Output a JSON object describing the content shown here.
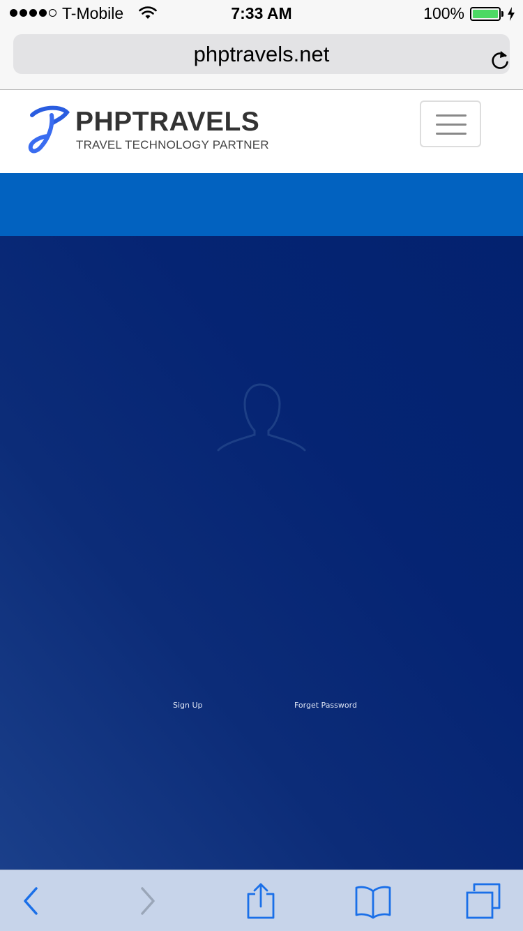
{
  "status_bar": {
    "carrier": "T-Mobile",
    "time": "7:33 AM",
    "battery_percent": "100%",
    "signal_bars_filled": 4,
    "signal_bars_total": 5,
    "battery_level": 1.0,
    "charging": true
  },
  "browser": {
    "url": "phptravels.net"
  },
  "header": {
    "logo_name": "PHPTRAVELS",
    "logo_tagline": "TRAVEL TECHNOLOGY PARTNER"
  },
  "login": {
    "signup_label": "Sign Up",
    "forget_password_label": "Forget Password"
  },
  "icons": {
    "status": [
      "wifi-icon",
      "battery-icon",
      "charging-bolt-icon"
    ],
    "url_bar": [
      "reload-icon"
    ],
    "header": [
      "logo-icon",
      "hamburger-menu-icon"
    ],
    "login": [
      "user-avatar-icon"
    ],
    "toolbar": [
      "back-icon",
      "forward-icon",
      "share-icon",
      "bookmarks-icon",
      "tabs-icon"
    ]
  },
  "colors": {
    "brand_blue": "#0262c0",
    "login_background": "#052473",
    "toolbar_tint": "#c7d4ea",
    "ios_accent": "#1a6fe8",
    "battery_green": "#4cd964"
  }
}
